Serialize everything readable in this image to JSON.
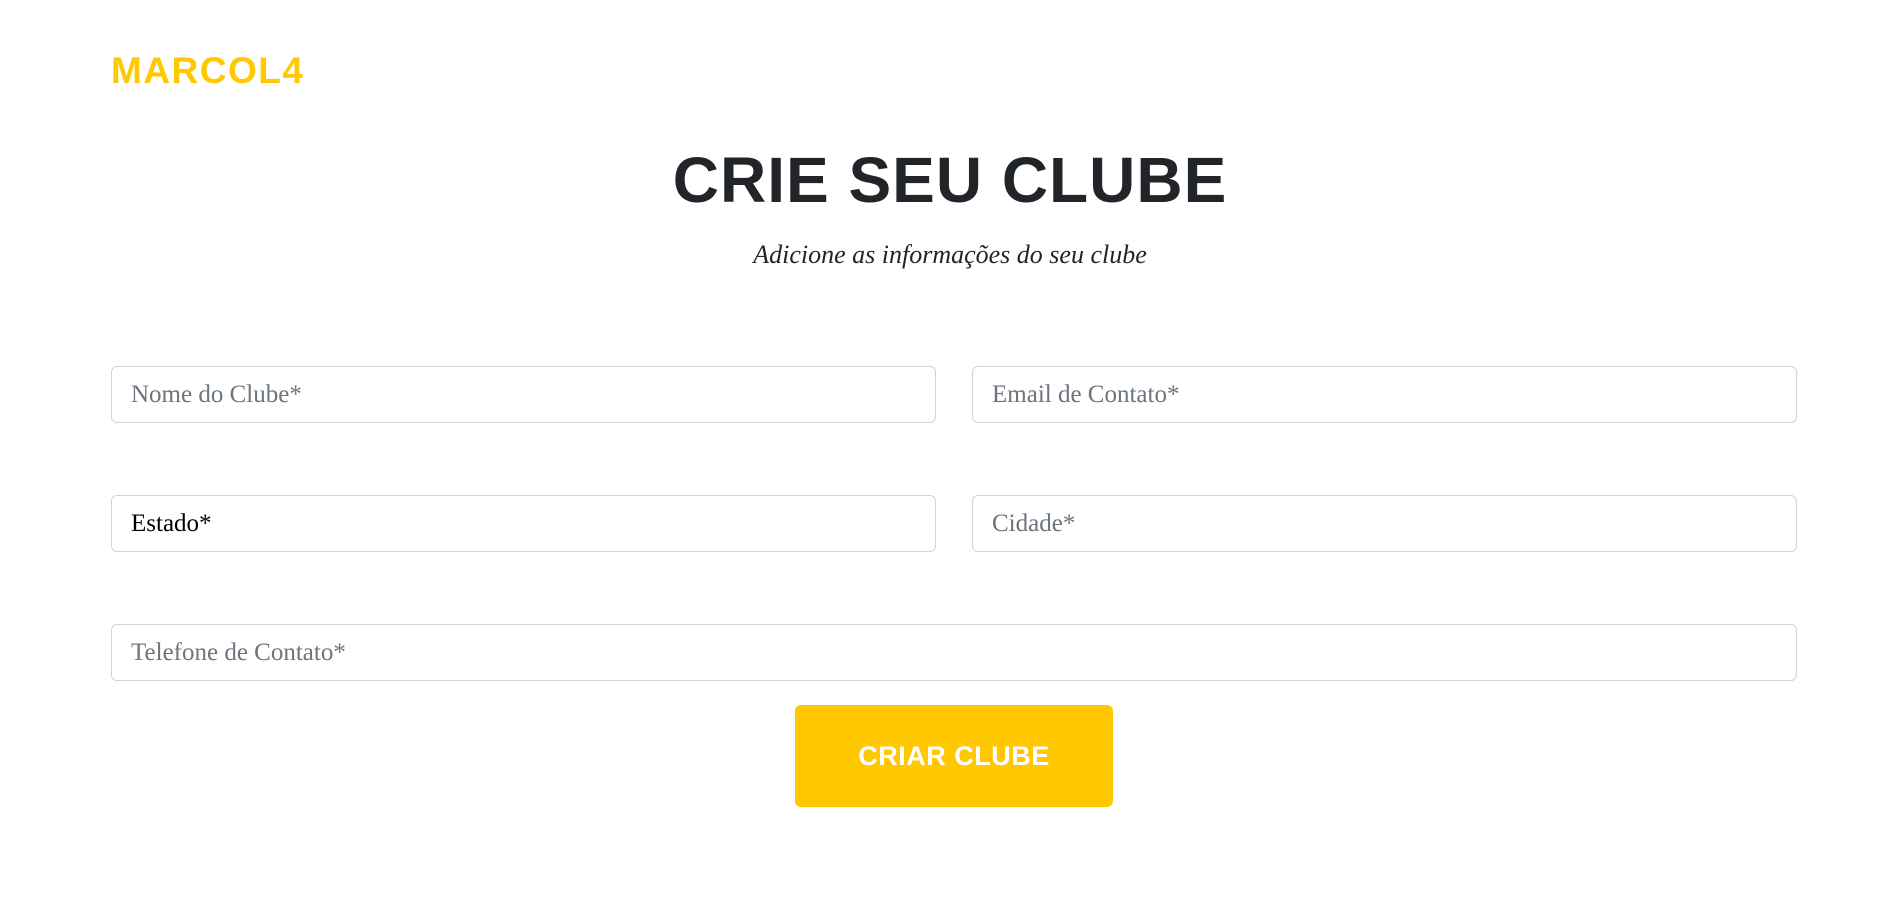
{
  "brand": {
    "name": "MARCOL4"
  },
  "header": {
    "title": "CRIE SEU CLUBE",
    "subtitle": "Adicione as informações do seu clube"
  },
  "form": {
    "club_name": {
      "placeholder": "Nome do Clube*",
      "value": ""
    },
    "contact_email": {
      "placeholder": "Email de Contato*",
      "value": ""
    },
    "state": {
      "selected": "Estado*"
    },
    "city": {
      "placeholder": "Cidade*",
      "value": ""
    },
    "contact_phone": {
      "placeholder": "Telefone de Contato*",
      "value": ""
    },
    "submit_label": "CRIAR CLUBE"
  },
  "colors": {
    "accent": "#ffc800",
    "heading": "#212529",
    "placeholder": "#6c757d",
    "border": "#ced4da"
  }
}
